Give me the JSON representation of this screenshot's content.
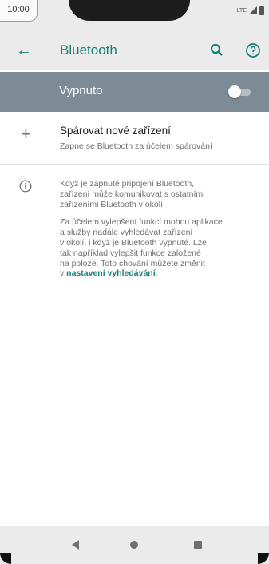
{
  "status_bar": {
    "time": "10:00",
    "network": "LTE"
  },
  "app_bar": {
    "back_icon": "arrow-left-icon",
    "title": "Bluetooth",
    "search_icon": "search-icon",
    "help_icon": "help-circle-icon"
  },
  "bluetooth_toggle": {
    "label": "Vypnuto",
    "state": "off"
  },
  "pair_device": {
    "title": "Spárovat nové zařízení",
    "subtitle": "Zapne se Bluetooth za účelem spárování"
  },
  "info": {
    "paragraph1": "Když je zapnuté připojení Bluetooth,\nzařízení může komunikovat s ostatními\nzařízeními Bluetooth v okolí.",
    "paragraph2_prefix": "Za účelem vylepšení funkcí mohou aplikace\na služby nadále vyhledávat zařízení\nv okolí, i když je Bluetooth vypnuté. Lze\ntak například vylepšit funkce založené\nna poloze. Toto chování můžete změnit\nv ",
    "link_text": "nastavení vyhledávání",
    "paragraph2_suffix": "."
  },
  "colors": {
    "accent": "#1a7f75",
    "toggle_bar": "#7c8b95",
    "app_bar": "#ebebeb"
  }
}
